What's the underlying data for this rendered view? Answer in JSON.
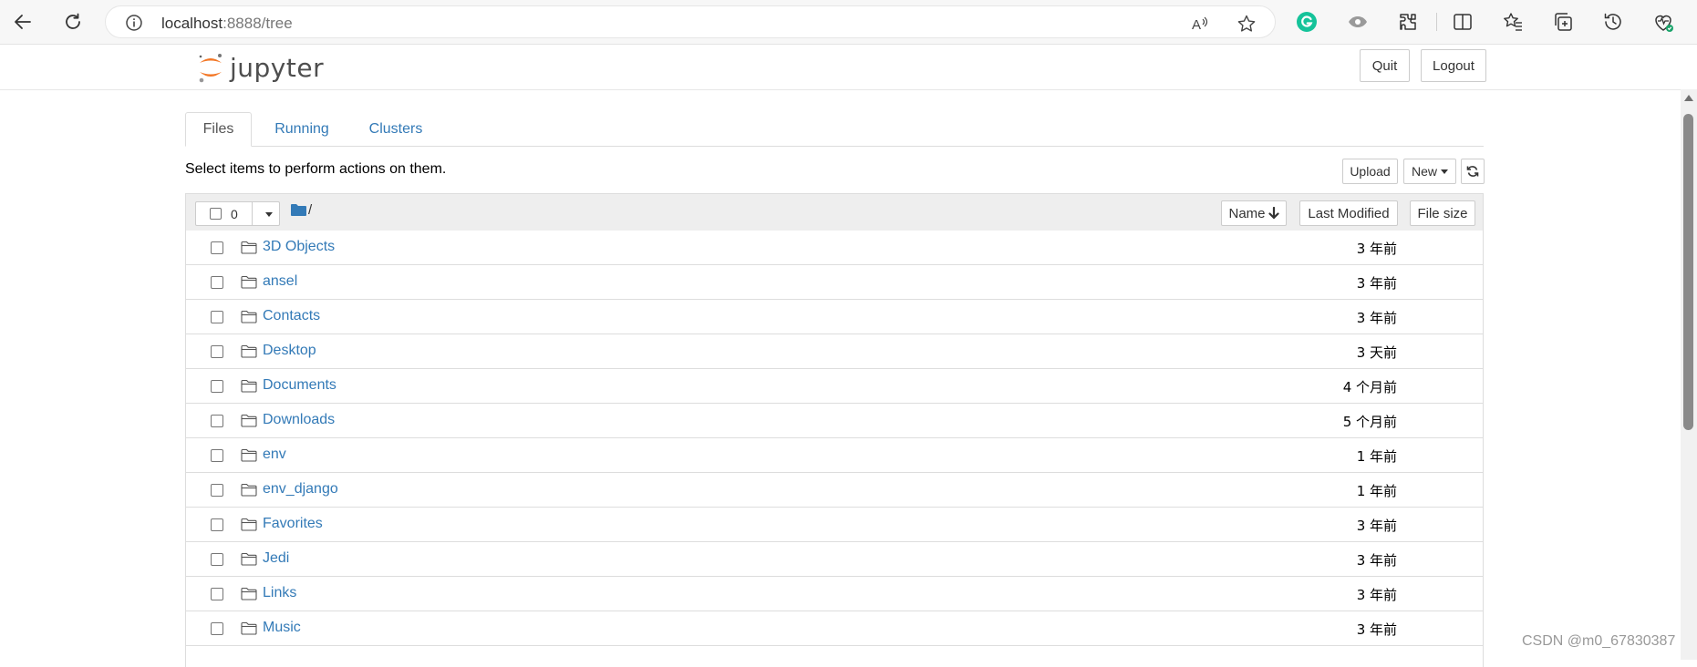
{
  "browser": {
    "url_host": "localhost",
    "url_rest": ":8888/tree"
  },
  "header": {
    "logo_text": "jupyter",
    "quit_label": "Quit",
    "logout_label": "Logout"
  },
  "tabs": [
    {
      "label": "Files",
      "active": true
    },
    {
      "label": "Running",
      "active": false
    },
    {
      "label": "Clusters",
      "active": false
    }
  ],
  "toolbar": {
    "instructions": "Select items to perform actions on them.",
    "upload_label": "Upload",
    "new_label": "New"
  },
  "list_header": {
    "selected_count": "0",
    "breadcrumb": "/",
    "name_label": "Name",
    "last_modified_label": "Last Modified",
    "file_size_label": "File size"
  },
  "files": [
    {
      "name": "3D Objects",
      "modified": "3 年前"
    },
    {
      "name": "ansel",
      "modified": "3 年前"
    },
    {
      "name": "Contacts",
      "modified": "3 年前"
    },
    {
      "name": "Desktop",
      "modified": "3 天前"
    },
    {
      "name": "Documents",
      "modified": "4 个月前"
    },
    {
      "name": "Downloads",
      "modified": "5 个月前"
    },
    {
      "name": "env",
      "modified": "1 年前"
    },
    {
      "name": "env_django",
      "modified": "1 年前"
    },
    {
      "name": "Favorites",
      "modified": "3 年前"
    },
    {
      "name": "Jedi",
      "modified": "3 年前"
    },
    {
      "name": "Links",
      "modified": "3 年前"
    },
    {
      "name": "Music",
      "modified": "3 年前"
    }
  ],
  "watermark": "CSDN @m0_67830387",
  "colors": {
    "link": "#337ab7",
    "jupyter_orange": "#f37726",
    "header_bg": "#eeeeee"
  }
}
